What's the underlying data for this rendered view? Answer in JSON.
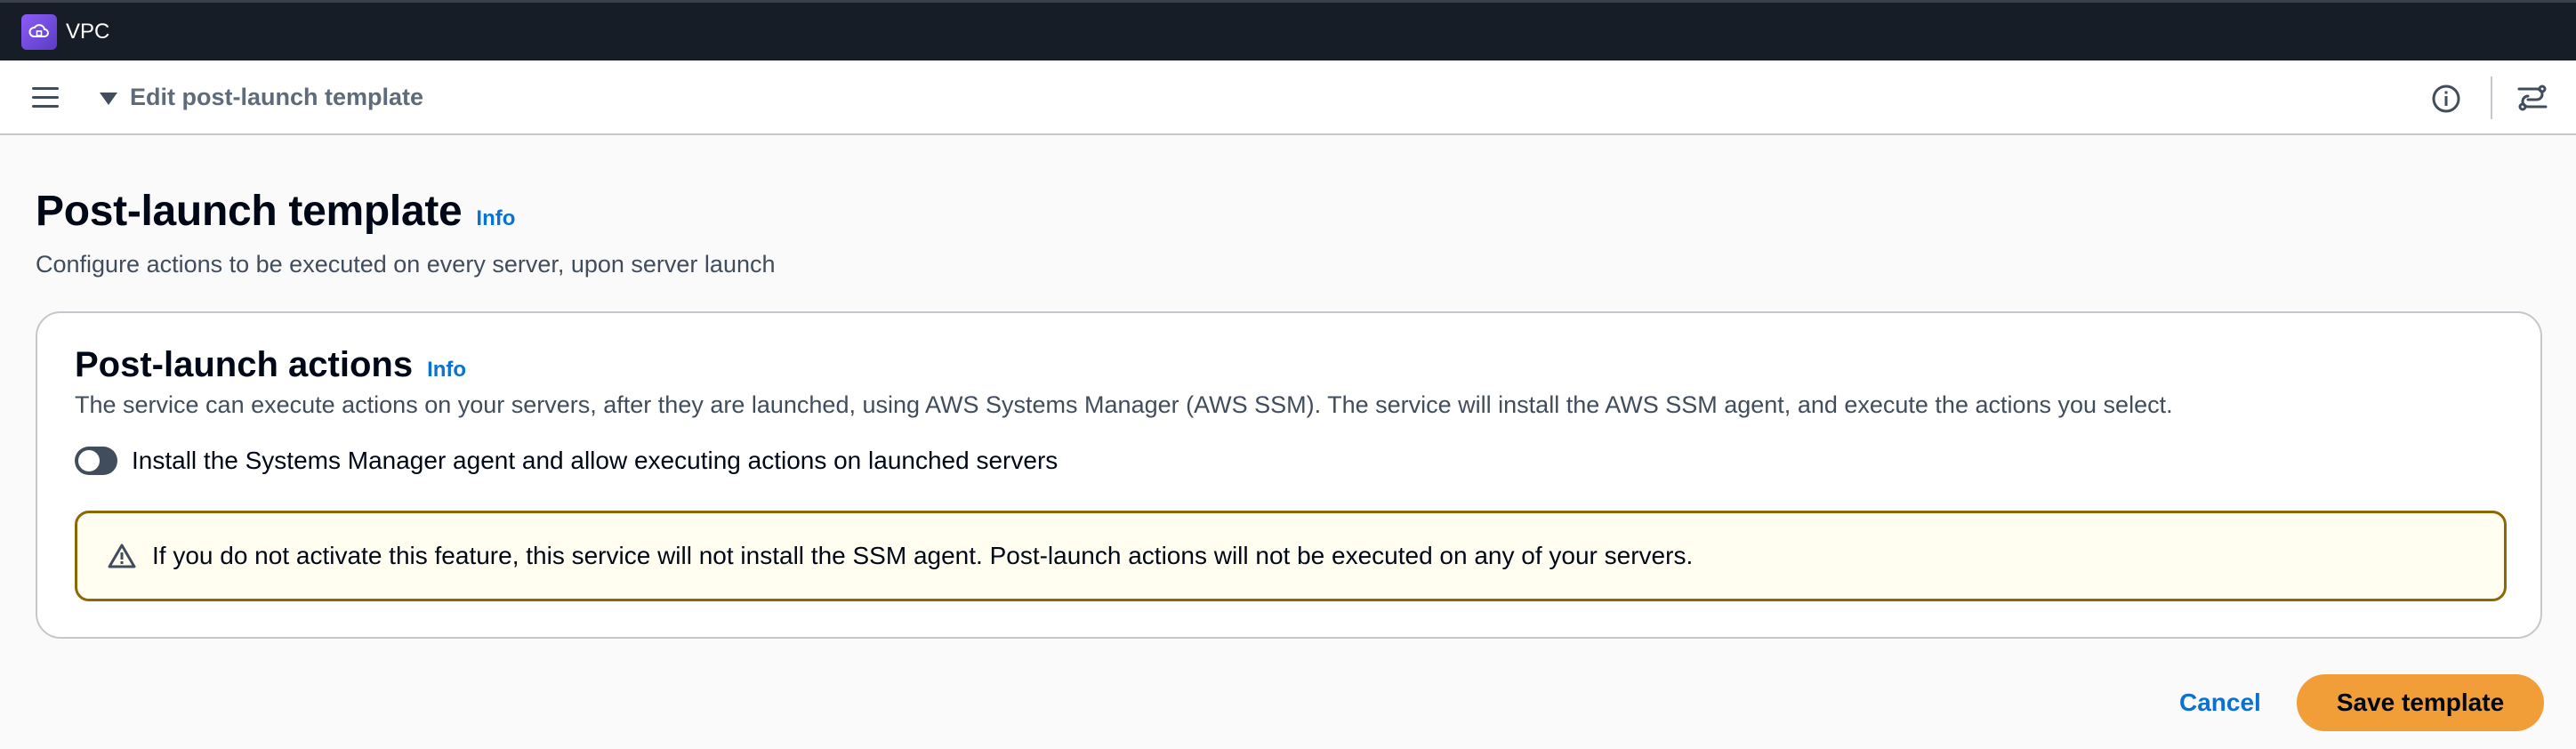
{
  "service": {
    "name": "VPC",
    "icon": "vpc-icon",
    "brand_color": "#7c4dff"
  },
  "header": {
    "menu_icon": "hamburger-menu-icon",
    "breadcrumb": "Edit post-launch template",
    "info_icon": "info-circle-icon",
    "split_panel_icon": "split-panel-icon"
  },
  "page": {
    "title": "Post-launch template",
    "info_link": "Info",
    "description": "Configure actions to be executed on every server, upon server launch"
  },
  "card": {
    "title": "Post-launch actions",
    "info_link": "Info",
    "description": "The service can execute actions on your servers, after they are launched, using AWS Systems Manager (AWS SSM). The service will install the AWS SSM agent, and execute the actions you select.",
    "toggle": {
      "label": "Install the Systems Manager agent and allow executing actions on launched servers",
      "checked": false
    },
    "alert": {
      "icon": "warning-icon",
      "text": "If you do not activate this feature, this service will not install the SSM agent. Post-launch actions will not be executed on any of your servers.",
      "border_color": "#8d6605",
      "background_color": "#fffef0"
    }
  },
  "footer": {
    "cancel_label": "Cancel",
    "save_label": "Save template",
    "save_color": "#f19e38",
    "link_color": "#0972d3"
  }
}
